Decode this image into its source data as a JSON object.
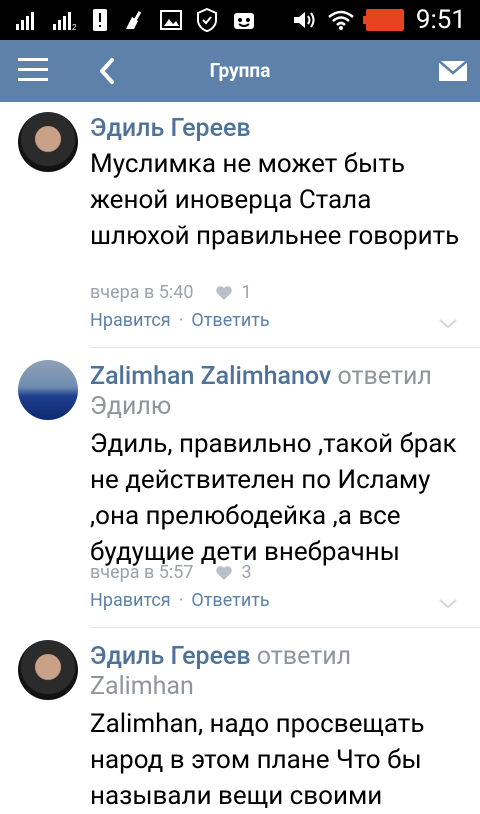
{
  "status_bar": {
    "time": "9:51"
  },
  "app_bar": {
    "title": "Группа"
  },
  "comments": [
    {
      "author": "Эдиль Гереев",
      "reply_word": "",
      "reply_to": "",
      "text": "Муслимка не может быть женой иноверца Стала шлюхой правильнее говорить",
      "time": "вчера в 5:40",
      "likes": "1",
      "like_label": "Нравится",
      "reply_label": "Ответить"
    },
    {
      "author": "Zalimhan Zalimhanov",
      "reply_word": "ответил",
      "reply_to": "Эдилю",
      "text": "Эдиль, правильно ,такой брак не действителен по Исламу ,она прелюбодейка ,а все будущие дети внебрачны",
      "time": "вчера в 5:57",
      "likes": "3",
      "like_label": "Нравится",
      "reply_label": "Ответить"
    },
    {
      "author": "Эдиль Гереев",
      "reply_word": "ответил",
      "reply_to": "Zalimhan",
      "text": "Zalimhan, надо просвещать народ в этом плане Что бы называли вещи своими"
    }
  ],
  "colors": {
    "app_bar": "#5d81a8",
    "name": "#4f7398",
    "meta": "#9aa4ad",
    "battery": "#e8431f"
  }
}
